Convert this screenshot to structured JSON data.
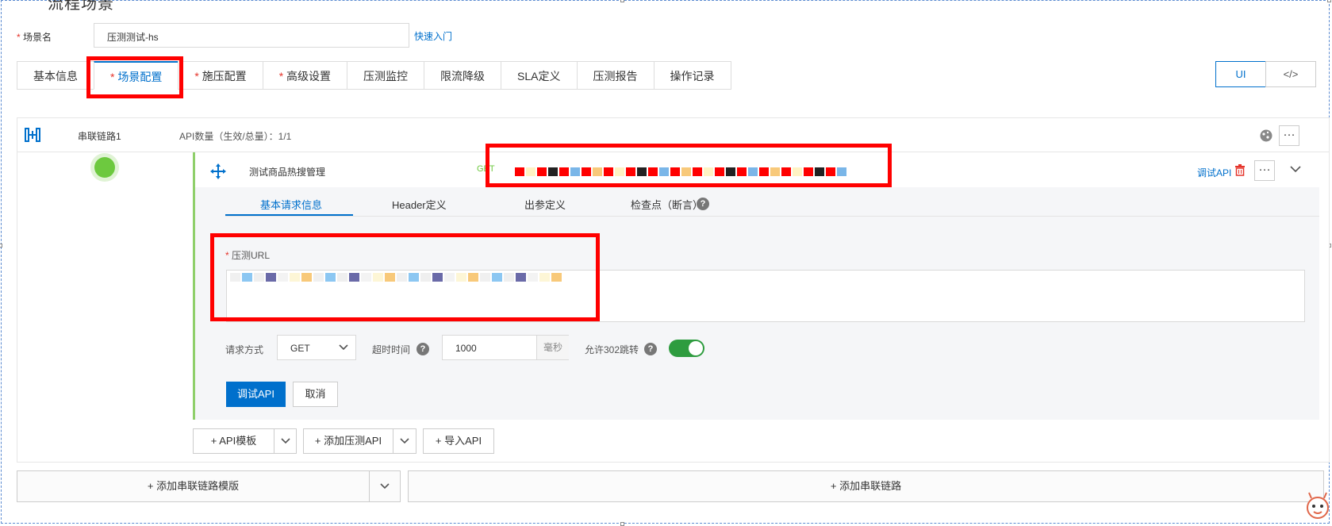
{
  "page": {
    "title_cut": "流程场景"
  },
  "scene": {
    "name_label": "场景名",
    "name_value": "压测测试-hs",
    "quickstart_link": "快速入门"
  },
  "tabs": [
    {
      "label": "基本信息",
      "required": false,
      "active": false
    },
    {
      "label": "场景配置",
      "required": true,
      "active": true
    },
    {
      "label": "施压配置",
      "required": true,
      "active": false
    },
    {
      "label": "高级设置",
      "required": true,
      "active": false
    },
    {
      "label": "压测监控",
      "required": false,
      "active": false
    },
    {
      "label": "限流降级",
      "required": false,
      "active": false
    },
    {
      "label": "SLA定义",
      "required": false,
      "active": false
    },
    {
      "label": "压测报告",
      "required": false,
      "active": false
    },
    {
      "label": "操作记录",
      "required": false,
      "active": false
    }
  ],
  "view_toggle": {
    "ui_label": "UI",
    "code_label": "</>"
  },
  "chain": {
    "name": "串联链路1",
    "api_count": "API数量（生效/总量）：1/1"
  },
  "api": {
    "name": "测试商品热搜管理",
    "method_tag": "GET",
    "debug_link": "调试API"
  },
  "sub_tabs": [
    "基本请求信息",
    "Header定义",
    "出参定义",
    "检查点（断言）"
  ],
  "form": {
    "url_label": "压测URL",
    "method_label": "请求方式",
    "method_value": "GET",
    "timeout_label": "超时时间",
    "timeout_value": "1000",
    "timeout_unit": "毫秒",
    "redirect_label": "允许302跳转",
    "redirect_enabled": true,
    "debug_button": "调试API",
    "cancel_button": "取消"
  },
  "bottom_actions": {
    "api_template": "+ API模板",
    "add_api": "+ 添加压测API",
    "import_api": "+ 导入API"
  },
  "footer": {
    "add_chain_template": "+ 添加串联链路模版",
    "add_chain": "+ 添加串联链路"
  },
  "colors": {
    "accent": "#0070cc",
    "required": "#e5342b",
    "annotation": "#ff0000",
    "active_green": "#6dc93f",
    "toggle_on": "#2e9c3f"
  }
}
